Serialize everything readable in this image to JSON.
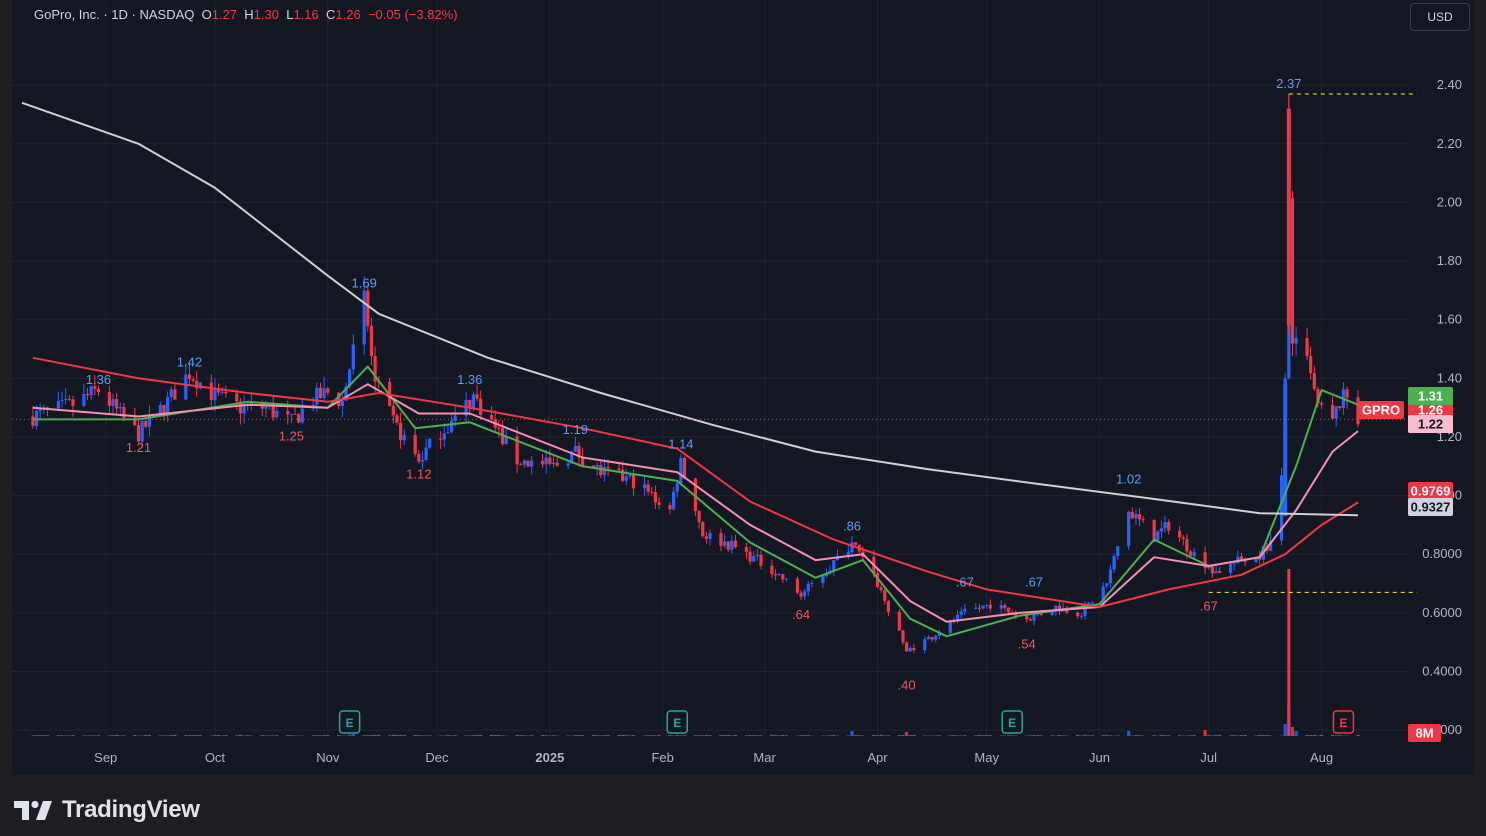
{
  "header": {
    "symbol": "GoPro, Inc. · 1D · NASDAQ",
    "o_label": "O",
    "o_value": "1.27",
    "h_label": "H",
    "h_value": "1.30",
    "l_label": "L",
    "l_value": "1.16",
    "c_label": "C",
    "c_value": "1.26",
    "change": "−0.05 (−3.82%)"
  },
  "currency_button": "USD",
  "brand": {
    "name": "TradingView"
  },
  "colors": {
    "background": "#131722",
    "up": "#2962ff",
    "down": "#f23645",
    "grid": "#1f2431",
    "axis_text": "#b2b5be",
    "ema_fast": "#4caf50",
    "ema_mid": "#f48fb1",
    "ema_slow": "#f23645",
    "sma_long": "#cfcfcf"
  },
  "chart_data": {
    "type": "candlestick",
    "symbol": "GPRO",
    "currency": "USD",
    "interval": "1D",
    "y_axis": {
      "ylim": [
        0.18,
        2.52
      ],
      "ticks": [
        0.2,
        0.4,
        0.6,
        0.8,
        1.0,
        1.2,
        1.4,
        1.6,
        1.8,
        2.0,
        2.2,
        2.4
      ],
      "tick_labels": [
        "0.2000",
        "0.4000",
        "0.6000",
        "0.8000",
        "1.00",
        "1.20",
        "1.40",
        "1.60",
        "1.80",
        "2.00",
        "2.20",
        "2.40"
      ],
      "position": "right"
    },
    "x_axis": {
      "labels": [
        "Sep",
        "Oct",
        "Nov",
        "Dec",
        "2025",
        "Feb",
        "Mar",
        "Apr",
        "May",
        "Jun",
        "Jul",
        "Aug"
      ],
      "label_dates": [
        "2024-09-01",
        "2024-10-01",
        "2024-11-01",
        "2024-12-01",
        "2025-01-01",
        "2025-02-01",
        "2025-03-01",
        "2025-04-01",
        "2025-05-01",
        "2025-06-01",
        "2025-07-01",
        "2025-08-01"
      ],
      "start": "2024-08-09",
      "end": "2025-08-11"
    },
    "grid": true,
    "ohlc_keypoints": [
      [
        "2024-08-12",
        1.27
      ],
      [
        "2024-08-23",
        1.31
      ],
      [
        "2024-08-30",
        1.36
      ],
      [
        "2024-09-06",
        1.26
      ],
      [
        "2024-09-10",
        1.21
      ],
      [
        "2024-09-18",
        1.32
      ],
      [
        "2024-09-24",
        1.42
      ],
      [
        "2024-10-01",
        1.34
      ],
      [
        "2024-10-08",
        1.3
      ],
      [
        "2024-10-15",
        1.3
      ],
      [
        "2024-10-22",
        1.25
      ],
      [
        "2024-10-28",
        1.33
      ],
      [
        "2024-11-01",
        1.35
      ],
      [
        "2024-11-05",
        1.32
      ],
      [
        "2024-11-11",
        1.67
      ],
      [
        "2024-11-14",
        1.38
      ],
      [
        "2024-11-19",
        1.25
      ],
      [
        "2024-11-26",
        1.12
      ],
      [
        "2024-12-02",
        1.22
      ],
      [
        "2024-12-06",
        1.26
      ],
      [
        "2024-12-11",
        1.34
      ],
      [
        "2024-12-16",
        1.25
      ],
      [
        "2024-12-23",
        1.12
      ],
      [
        "2025-01-02",
        1.1
      ],
      [
        "2025-01-08",
        1.15
      ],
      [
        "2025-01-15",
        1.08
      ],
      [
        "2025-01-24",
        1.05
      ],
      [
        "2025-02-03",
        0.95
      ],
      [
        "2025-02-06",
        1.12
      ],
      [
        "2025-02-12",
        0.87
      ],
      [
        "2025-02-20",
        0.83
      ],
      [
        "2025-03-03",
        0.75
      ],
      [
        "2025-03-11",
        0.66
      ],
      [
        "2025-03-20",
        0.77
      ],
      [
        "2025-03-25",
        0.84
      ],
      [
        "2025-04-01",
        0.7
      ],
      [
        "2025-04-09",
        0.47
      ],
      [
        "2025-04-16",
        0.52
      ],
      [
        "2025-04-25",
        0.6
      ],
      [
        "2025-05-02",
        0.63
      ],
      [
        "2025-05-12",
        0.58
      ],
      [
        "2025-05-20",
        0.62
      ],
      [
        "2025-05-27",
        0.6
      ],
      [
        "2025-06-03",
        0.7
      ],
      [
        "2025-06-09",
        0.95
      ],
      [
        "2025-06-16",
        0.86
      ],
      [
        "2025-06-20",
        0.9
      ],
      [
        "2025-06-27",
        0.8
      ],
      [
        "2025-07-03",
        0.74
      ],
      [
        "2025-07-10",
        0.78
      ],
      [
        "2025-07-15",
        0.8
      ],
      [
        "2025-07-18",
        0.84
      ],
      [
        "2025-07-21",
        1.05
      ],
      [
        "2025-07-22",
        1.4
      ],
      [
        "2025-07-23",
        2.0
      ],
      [
        "2025-07-24",
        1.55
      ],
      [
        "2025-07-28",
        1.45
      ],
      [
        "2025-07-31",
        1.3
      ],
      [
        "2025-08-04",
        1.25
      ],
      [
        "2025-08-06",
        1.32
      ],
      [
        "2025-08-08",
        1.34
      ],
      [
        "2025-08-11",
        1.26
      ]
    ],
    "series": [
      {
        "type": "line",
        "color": "#4caf50",
        "last_value": 1.31,
        "points": [
          [
            "2024-08-12",
            1.26
          ],
          [
            "2024-09-10",
            1.26
          ],
          [
            "2024-10-10",
            1.32
          ],
          [
            "2024-11-01",
            1.3
          ],
          [
            "2024-11-12",
            1.44
          ],
          [
            "2024-11-25",
            1.23
          ],
          [
            "2024-12-10",
            1.25
          ],
          [
            "2025-01-10",
            1.1
          ],
          [
            "2025-02-05",
            1.05
          ],
          [
            "2025-02-25",
            0.84
          ],
          [
            "2025-03-15",
            0.72
          ],
          [
            "2025-03-28",
            0.78
          ],
          [
            "2025-04-10",
            0.58
          ],
          [
            "2025-04-20",
            0.52
          ],
          [
            "2025-05-10",
            0.59
          ],
          [
            "2025-06-01",
            0.63
          ],
          [
            "2025-06-16",
            0.85
          ],
          [
            "2025-07-01",
            0.76
          ],
          [
            "2025-07-15",
            0.79
          ],
          [
            "2025-07-25",
            1.1
          ],
          [
            "2025-08-01",
            1.36
          ],
          [
            "2025-08-11",
            1.31
          ]
        ]
      },
      {
        "type": "line",
        "color": "#f48fb1",
        "last_value": 1.22,
        "points": [
          [
            "2024-08-12",
            1.3
          ],
          [
            "2024-09-10",
            1.27
          ],
          [
            "2024-10-10",
            1.31
          ],
          [
            "2024-11-01",
            1.3
          ],
          [
            "2024-11-12",
            1.38
          ],
          [
            "2024-11-26",
            1.28
          ],
          [
            "2024-12-10",
            1.28
          ],
          [
            "2025-01-10",
            1.13
          ],
          [
            "2025-02-05",
            1.08
          ],
          [
            "2025-02-25",
            0.9
          ],
          [
            "2025-03-15",
            0.78
          ],
          [
            "2025-03-28",
            0.8
          ],
          [
            "2025-04-10",
            0.64
          ],
          [
            "2025-04-20",
            0.57
          ],
          [
            "2025-05-10",
            0.6
          ],
          [
            "2025-06-01",
            0.62
          ],
          [
            "2025-06-16",
            0.79
          ],
          [
            "2025-07-01",
            0.76
          ],
          [
            "2025-07-15",
            0.79
          ],
          [
            "2025-07-25",
            0.95
          ],
          [
            "2025-08-04",
            1.15
          ],
          [
            "2025-08-11",
            1.22
          ]
        ]
      },
      {
        "type": "line",
        "color": "#f23645",
        "last_value": 0.9769,
        "points": [
          [
            "2024-08-12",
            1.47
          ],
          [
            "2024-09-10",
            1.4
          ],
          [
            "2024-10-10",
            1.35
          ],
          [
            "2024-11-01",
            1.32
          ],
          [
            "2024-11-15",
            1.35
          ],
          [
            "2024-12-10",
            1.3
          ],
          [
            "2025-01-10",
            1.23
          ],
          [
            "2025-02-05",
            1.16
          ],
          [
            "2025-02-25",
            0.98
          ],
          [
            "2025-03-20",
            0.85
          ],
          [
            "2025-04-15",
            0.74
          ],
          [
            "2025-05-01",
            0.68
          ],
          [
            "2025-06-01",
            0.62
          ],
          [
            "2025-06-20",
            0.68
          ],
          [
            "2025-07-10",
            0.73
          ],
          [
            "2025-07-22",
            0.8
          ],
          [
            "2025-08-01",
            0.9
          ],
          [
            "2025-08-11",
            0.9769
          ]
        ]
      },
      {
        "type": "line",
        "color": "#cfcfcf",
        "last_value": 0.9327,
        "points": [
          [
            "2024-08-09",
            2.34
          ],
          [
            "2024-09-10",
            2.2
          ],
          [
            "2024-10-01",
            2.05
          ],
          [
            "2024-11-01",
            1.75
          ],
          [
            "2024-11-15",
            1.62
          ],
          [
            "2024-12-15",
            1.47
          ],
          [
            "2025-01-15",
            1.35
          ],
          [
            "2025-02-15",
            1.24
          ],
          [
            "2025-03-15",
            1.15
          ],
          [
            "2025-04-15",
            1.09
          ],
          [
            "2025-05-15",
            1.04
          ],
          [
            "2025-06-15",
            0.99
          ],
          [
            "2025-07-15",
            0.94
          ],
          [
            "2025-08-11",
            0.9327
          ]
        ]
      }
    ],
    "high_low_labels": [
      {
        "date": "2024-08-30",
        "value": 1.36,
        "text": "1.36",
        "kind": "high"
      },
      {
        "date": "2024-09-24",
        "value": 1.42,
        "text": "1.42",
        "kind": "high"
      },
      {
        "date": "2024-11-11",
        "value": 1.69,
        "text": "1.69",
        "kind": "high"
      },
      {
        "date": "2024-12-10",
        "value": 1.36,
        "text": "1.36",
        "kind": "high"
      },
      {
        "date": "2025-01-08",
        "value": 1.19,
        "text": "1.19",
        "kind": "high"
      },
      {
        "date": "2025-02-06",
        "value": 1.14,
        "text": "1.14",
        "kind": "high"
      },
      {
        "date": "2025-03-25",
        "value": 0.86,
        "text": ".86",
        "kind": "high"
      },
      {
        "date": "2025-04-25",
        "value": 0.67,
        "text": ".67",
        "kind": "high"
      },
      {
        "date": "2025-05-14",
        "value": 0.67,
        "text": ".67",
        "kind": "high"
      },
      {
        "date": "2025-06-09",
        "value": 1.02,
        "text": "1.02",
        "kind": "high"
      },
      {
        "date": "2025-07-23",
        "value": 2.37,
        "text": "2.37",
        "kind": "high"
      },
      {
        "date": "2024-09-10",
        "value": 1.21,
        "text": "1.21",
        "kind": "low"
      },
      {
        "date": "2024-10-22",
        "value": 1.25,
        "text": "1.25",
        "kind": "low"
      },
      {
        "date": "2024-11-26",
        "value": 1.12,
        "text": "1.12",
        "kind": "low"
      },
      {
        "date": "2025-03-11",
        "value": 0.64,
        "text": ".64",
        "kind": "low"
      },
      {
        "date": "2025-04-09",
        "value": 0.4,
        "text": ".40",
        "kind": "low"
      },
      {
        "date": "2025-05-12",
        "value": 0.54,
        "text": ".54",
        "kind": "low"
      },
      {
        "date": "2025-07-01",
        "value": 0.67,
        "text": ".67",
        "kind": "low"
      }
    ],
    "dashed_levels": [
      {
        "value": 2.37,
        "from": "2025-07-23",
        "color": "#ffeb3b"
      },
      {
        "value": 0.67,
        "from": "2025-07-01",
        "color": "#ffeb3b"
      }
    ],
    "last_price_line": {
      "value": 1.26,
      "color": "#f23645"
    },
    "price_labels": [
      {
        "text": "GPRO",
        "value": 1.26,
        "color": "#f23645",
        "kind": "symbol"
      },
      {
        "text": "1.26",
        "value": 1.26,
        "color": "#f23645",
        "kind": "price"
      },
      {
        "text": "1.31",
        "value": 1.31,
        "color": "#4caf50",
        "kind": "price"
      },
      {
        "text": "1.22",
        "value": 1.22,
        "color": "#f8bbd0",
        "kind": "price"
      },
      {
        "text": "0.9769",
        "value": 0.9769,
        "color": "#f23645",
        "kind": "price"
      },
      {
        "text": "0.9327",
        "value": 0.9327,
        "color": "#d1d4dc",
        "kind": "price"
      }
    ],
    "earnings_markers": [
      {
        "date": "2024-11-07",
        "text": "E"
      },
      {
        "date": "2025-02-05",
        "text": "E"
      },
      {
        "date": "2025-05-08",
        "text": "E"
      },
      {
        "date": "2025-08-07",
        "text": "E"
      }
    ],
    "volume": {
      "label": "8M",
      "spikes": [
        [
          "2024-11-08",
          2.0
        ],
        [
          "2025-03-25",
          5.0
        ],
        [
          "2025-04-09",
          4.0
        ],
        [
          "2025-06-09",
          5.0
        ],
        [
          "2025-06-30",
          6.0
        ],
        [
          "2025-07-22",
          12.0
        ],
        [
          "2025-07-23",
          30.0
        ],
        [
          "2025-07-24",
          9.0
        ],
        [
          "2025-07-25",
          5.0
        ]
      ]
    }
  }
}
